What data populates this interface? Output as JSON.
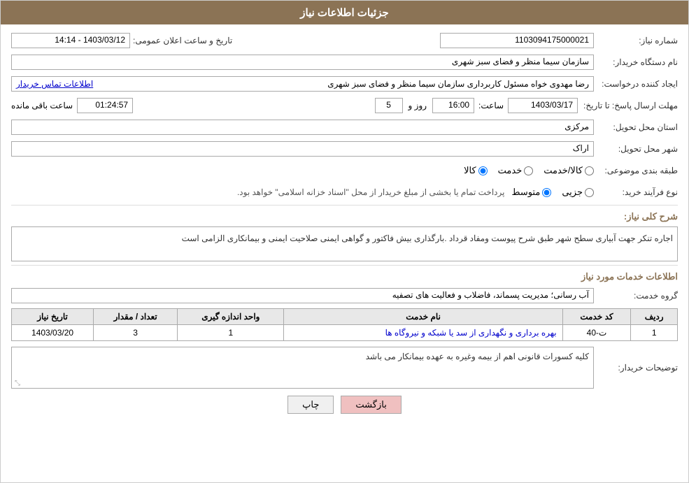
{
  "header": {
    "title": "جزئیات اطلاعات نیاز"
  },
  "fields": {
    "order_number_label": "شماره نیاز:",
    "order_number_value": "1103094175000021",
    "buyer_org_label": "نام دستگاه خریدار:",
    "buyer_org_value": "سازمان سیما منظر و فضای سبز شهری",
    "creator_label": "ایجاد کننده درخواست:",
    "creator_value": "رضا مهدوی خواه مسئول کاربرداری سازمان سیما منظر و فضای سبز شهری",
    "creator_link": "اطلاعات تماس خریدار",
    "deadline_label": "مهلت ارسال پاسخ: تا تاریخ:",
    "deadline_date": "1403/03/17",
    "deadline_time_label": "ساعت:",
    "deadline_time": "16:00",
    "deadline_day_label": "روز و",
    "deadline_days": "5",
    "deadline_remaining_label": "ساعت باقی مانده",
    "deadline_remaining": "01:24:57",
    "delivery_province_label": "استان محل تحویل:",
    "delivery_province_value": "مرکزی",
    "delivery_city_label": "شهر محل تحویل:",
    "delivery_city_value": "اراک",
    "announce_date_label": "تاریخ و ساعت اعلان عمومی:",
    "announce_date_value": "1403/03/12 - 14:14",
    "category_label": "طبقه بندی موضوعی:",
    "category_options": [
      "کالا",
      "خدمت",
      "کالا/خدمت"
    ],
    "category_selected": "کالا",
    "purchase_type_label": "نوع فرآیند خرید:",
    "purchase_options": [
      "جزیی",
      "متوسط",
      ""
    ],
    "purchase_selected_text": "پرداخت تمام یا بخشی از مبلغ خریدار از محل \"اسناد خزانه اسلامی\" خواهد بود.",
    "description_title": "شرح کلی نیاز:",
    "description_text": "اجاره تنکر جهت آبیاری سطح شهر طبق شرح پیوست ومفاد قرداد .بارگذاری بیش فاکتور و گواهی ایمنی صلاحیت ایمنی و بیمانکاری الزامی است",
    "services_title": "اطلاعات خدمات مورد نیاز",
    "service_group_label": "گروه خدمت:",
    "service_group_value": "آب رسانی؛ مدیریت پسماند، فاضلاب و فعالیت های تصفیه",
    "table_headers": [
      "ردیف",
      "کد خدمت",
      "نام خدمت",
      "واحد اندازه گیری",
      "تعداد / مقدار",
      "تاریخ نیاز"
    ],
    "table_rows": [
      {
        "row": "1",
        "code": "ت-40",
        "name": "بهره برداری و نگهداری از سد یا شبکه و نیروگاه ها",
        "unit": "1",
        "quantity": "3",
        "date": "1403/03/20"
      }
    ],
    "buyer_notes_label": "توضیحات خریدار:",
    "buyer_notes_value": "کلیه کسورات قانونی اهم از بیمه وغیره به عهده بیمانکار می باشد"
  },
  "buttons": {
    "back_label": "بازگشت",
    "print_label": "چاپ"
  }
}
